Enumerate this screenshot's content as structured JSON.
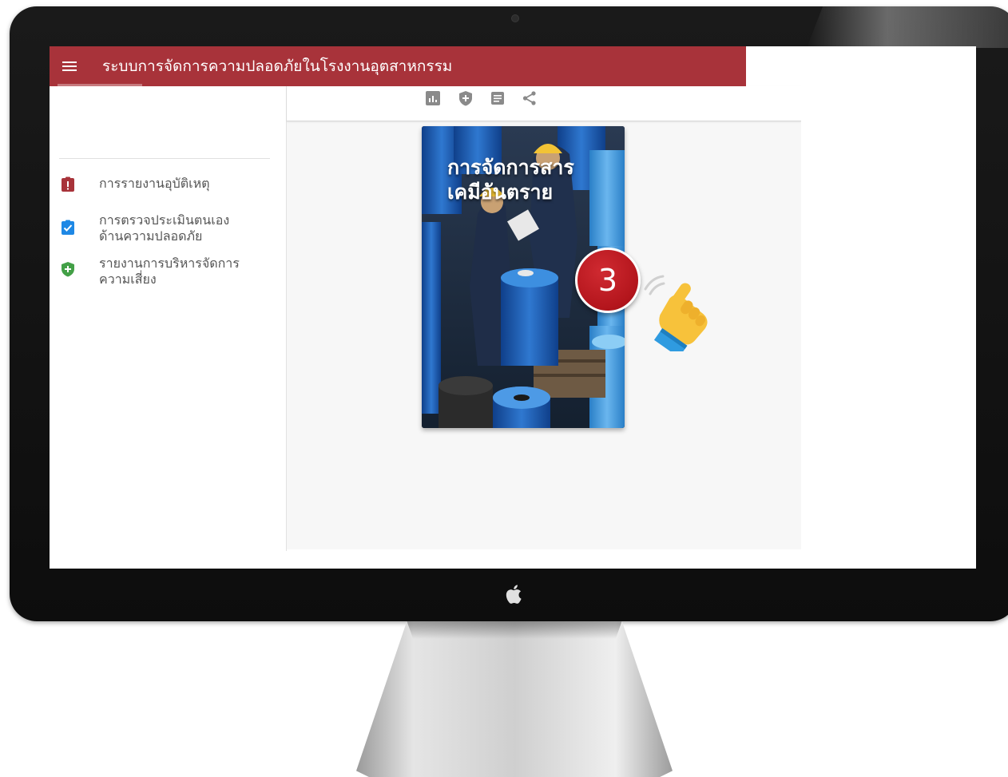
{
  "app": {
    "title": "ระบบการจัดการความปลอดภัยในโรงงานอุตสาหกรรม",
    "accent_color": "#a8333a"
  },
  "sidebar": {
    "items": [
      {
        "label": "การรายงานอุบัติเหตุ",
        "icon": "clipboard-alert-icon",
        "icon_color": "#a8333a"
      },
      {
        "label": "การตรวจประเมินตนเอง\nด้านความปลอดภัย",
        "icon": "clipboard-check-icon",
        "icon_color": "#1e88e5"
      },
      {
        "label": "รายงานการบริหารจัดการ\nความเสี่ยง",
        "icon": "shield-plus-icon",
        "icon_color": "#43a047"
      }
    ]
  },
  "toolbar": {
    "tools": [
      {
        "icon": "report-chart-icon"
      },
      {
        "icon": "shield-plus-icon"
      },
      {
        "icon": "document-icon"
      },
      {
        "icon": "share-icon"
      }
    ]
  },
  "cover": {
    "title": "การจัดการสาร\nเคมีอันตราย"
  },
  "overlay": {
    "step_number": "3",
    "pointer": "tap-hand-icon"
  }
}
